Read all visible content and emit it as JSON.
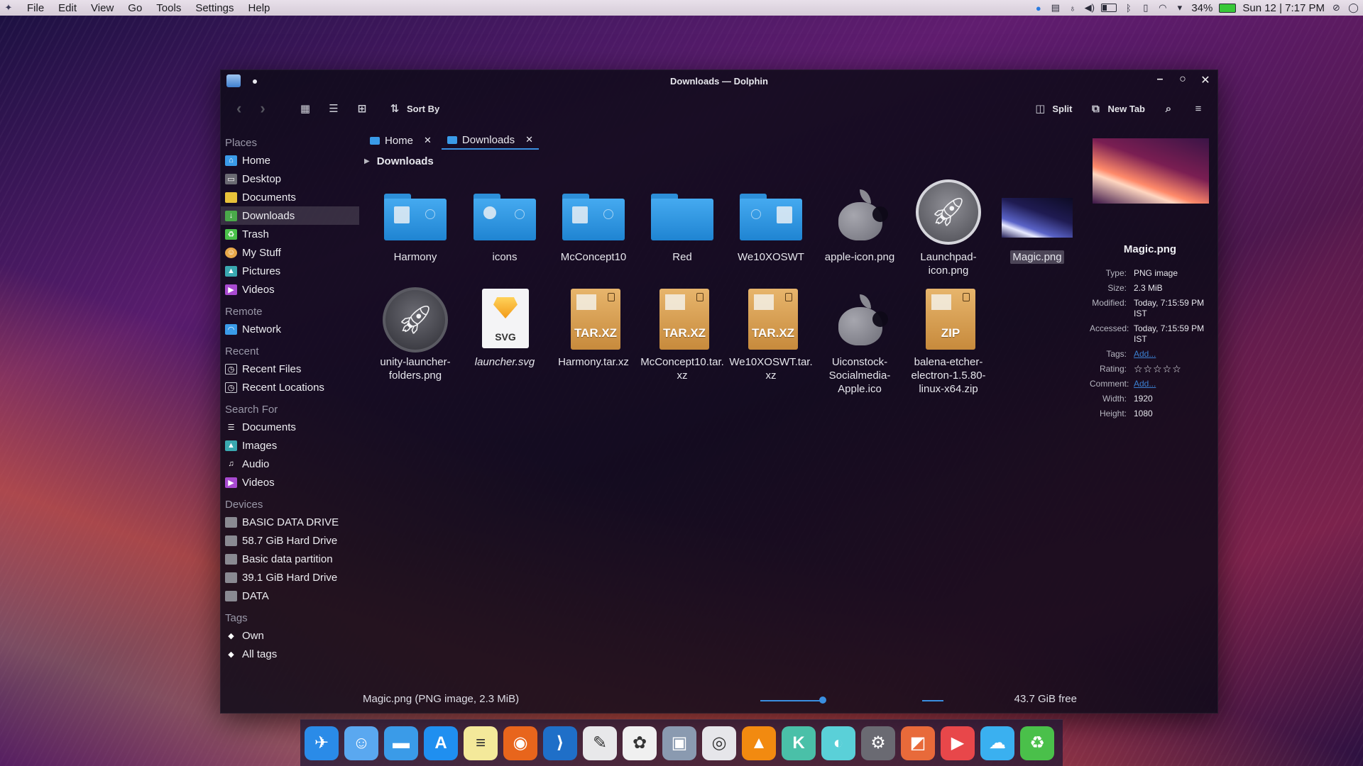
{
  "menubar": {
    "items": [
      "File",
      "Edit",
      "View",
      "Go",
      "Tools",
      "Settings",
      "Help"
    ],
    "battery_percent": "34%",
    "clock": "Sun 12 | 7:17 PM"
  },
  "window": {
    "title": "Downloads — Dolphin",
    "toolbar": {
      "sort_label": "Sort By",
      "split_label": "Split",
      "new_tab_label": "New Tab"
    },
    "tabs": [
      {
        "label": "Home"
      },
      {
        "label": "Downloads"
      }
    ],
    "breadcrumb": "Downloads"
  },
  "sidebar": {
    "places_title": "Places",
    "places": [
      "Home",
      "Desktop",
      "Documents",
      "Downloads",
      "Trash",
      "My Stuff",
      "Pictures",
      "Videos"
    ],
    "remote_title": "Remote",
    "remote": [
      "Network"
    ],
    "recent_title": "Recent",
    "recent": [
      "Recent Files",
      "Recent Locations"
    ],
    "search_title": "Search For",
    "search": [
      "Documents",
      "Images",
      "Audio",
      "Videos"
    ],
    "devices_title": "Devices",
    "devices": [
      "BASIC DATA DRIVE",
      "58.7 GiB Hard Drive",
      "Basic data partition",
      "39.1 GiB Hard Drive",
      "DATA"
    ],
    "tags_title": "Tags",
    "tags": [
      "Own",
      "All tags"
    ]
  },
  "files": [
    {
      "name": "Harmony"
    },
    {
      "name": "icons"
    },
    {
      "name": "McConcept10"
    },
    {
      "name": "Red"
    },
    {
      "name": "We10XOSWT"
    },
    {
      "name": "apple-icon.png"
    },
    {
      "name": "Launchpad-icon.png"
    },
    {
      "name": "Magic.png"
    },
    {
      "name": "unity-launcher-folders.png"
    },
    {
      "name": "launcher.svg",
      "badge": "SVG"
    },
    {
      "name": "Harmony.tar.xz",
      "badge": "TAR.XZ"
    },
    {
      "name": "McConcept10.tar.xz",
      "badge": "TAR.XZ"
    },
    {
      "name": "We10XOSWT.tar.xz",
      "badge": "TAR.XZ"
    },
    {
      "name": "Uiconstock-Socialmedia-Apple.ico"
    },
    {
      "name": "balena-etcher-electron-1.5.80-linux-x64.zip",
      "badge": "ZIP"
    }
  ],
  "info": {
    "title": "Magic.png",
    "type_k": "Type:",
    "type_v": "PNG image",
    "size_k": "Size:",
    "size_v": "2.3 MiB",
    "modified_k": "Modified:",
    "modified_v": "Today, 7:15:59 PM IST",
    "accessed_k": "Accessed:",
    "accessed_v": "Today, 7:15:59 PM IST",
    "tags_k": "Tags:",
    "tags_v": "Add...",
    "rating_k": "Rating:",
    "rating_value": 0,
    "rating_max": 5,
    "comment_k": "Comment:",
    "comment_v": "Add...",
    "width_k": "Width:",
    "width_v": "1920",
    "height_k": "Height:",
    "height_v": "1080"
  },
  "status": {
    "message": "Magic.png (PNG image, 2.3 MiB)",
    "free": "43.7 GiB free"
  },
  "dock": [
    {
      "name": "launcher-icon",
      "color": "#2a8be8"
    },
    {
      "name": "finder-icon",
      "color": "#5aa8f0"
    },
    {
      "name": "files-icon",
      "color": "#3a9be8"
    },
    {
      "name": "app-store-icon",
      "color": "#1f8ff0"
    },
    {
      "name": "notes-icon",
      "color": "#f4e99a"
    },
    {
      "name": "firefox-icon",
      "color": "#e8651c"
    },
    {
      "name": "vscode-icon",
      "color": "#1f6fc8"
    },
    {
      "name": "text-editor-icon",
      "color": "#e8e8ea"
    },
    {
      "name": "photos-icon",
      "color": "#f0f0f0"
    },
    {
      "name": "image-viewer-icon",
      "color": "#8a9ab0"
    },
    {
      "name": "screenshot-icon",
      "color": "#e6e6ea"
    },
    {
      "name": "vlc-icon",
      "color": "#f28a10"
    },
    {
      "name": "kvantum-icon",
      "color": "#4ac0a8"
    },
    {
      "name": "moon-icon",
      "color": "#5ad0d8"
    },
    {
      "name": "system-settings-icon",
      "color": "#6a6a72"
    },
    {
      "name": "preview-icon",
      "color": "#e86a3a"
    },
    {
      "name": "facetime-icon",
      "color": "#e8474a"
    },
    {
      "name": "cloud-folder-icon",
      "color": "#3ab0f0"
    },
    {
      "name": "recycle-bin-icon",
      "color": "#4ac04a"
    }
  ]
}
